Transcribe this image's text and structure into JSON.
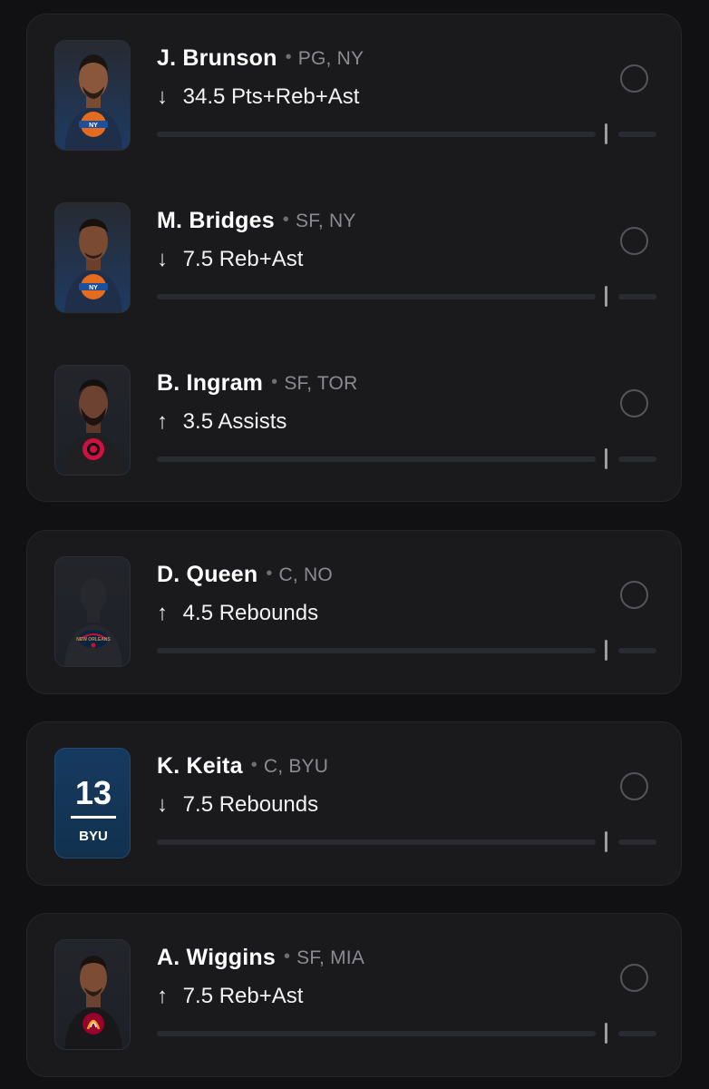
{
  "colors": {
    "background": "#111114",
    "card": "#1a1a1d",
    "track": "#2a2b30",
    "muted_text": "#8b8c92"
  },
  "players": [
    {
      "name": "J. Brunson",
      "pos_team": "PG, NY",
      "direction": "down",
      "arrow": "↓",
      "line": "34.5 Pts+Reb+Ast",
      "avatar": "knicks-player-headshot"
    },
    {
      "name": "M. Bridges",
      "pos_team": "SF, NY",
      "direction": "down",
      "arrow": "↓",
      "line": "7.5 Reb+Ast",
      "avatar": "knicks-player-headshot"
    },
    {
      "name": "B. Ingram",
      "pos_team": "SF, TOR",
      "direction": "up",
      "arrow": "↑",
      "line": "3.5 Assists",
      "avatar": "raptors-player-headshot"
    },
    {
      "name": "D. Queen",
      "pos_team": "C, NO",
      "direction": "up",
      "arrow": "↑",
      "line": "4.5 Rebounds",
      "avatar": "pelicans-placeholder-silhouette"
    },
    {
      "name": "K. Keita",
      "pos_team": "C, BYU",
      "direction": "down",
      "arrow": "↓",
      "line": "7.5 Rebounds",
      "avatar": "byu-jersey-number",
      "jersey_number": "13",
      "jersey_team": "BYU"
    },
    {
      "name": "A. Wiggins",
      "pos_team": "SF, MIA",
      "direction": "up",
      "arrow": "↑",
      "line": "7.5 Reb+Ast",
      "avatar": "heat-player-headshot"
    }
  ]
}
